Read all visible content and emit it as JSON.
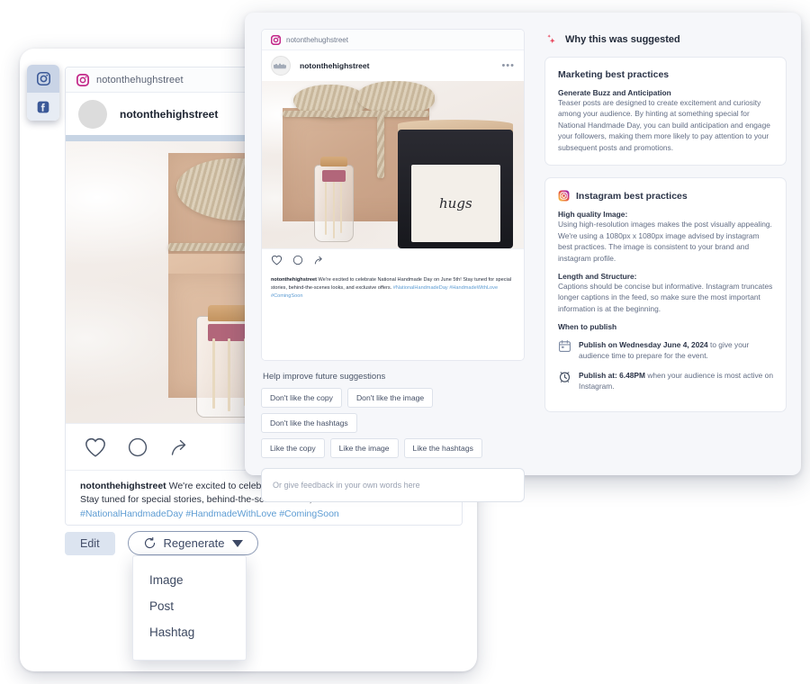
{
  "channels": [
    {
      "name": "instagram-channel-button",
      "icon": "instagram-icon",
      "active": true
    },
    {
      "name": "facebook-channel-button",
      "icon": "facebook-icon",
      "active": false
    }
  ],
  "post_preview": {
    "tab_label": "notonthehughstreet",
    "account_name": "notonthehighstreet",
    "caption_user": "notonthehighstreet",
    "caption_text": "We're excited to celebrate National Handmade Day on June 5th! Stay tuned for special stories, behind-the-scenes looks, and exclusive offers.",
    "hashtags": "#NationalHandmadeDay #HandmadeWithLove #ComingSoon",
    "image_alt_label": "hugs",
    "actions": [
      "like-icon",
      "comment-icon",
      "share-icon"
    ],
    "more_options": "•••"
  },
  "footer": {
    "edit_label": "Edit",
    "regenerate_label": "Regenerate"
  },
  "regenerate_menu": {
    "items": [
      "Image",
      "Post",
      "Hashtag"
    ]
  },
  "feedback": {
    "title": "Help improve future suggestions",
    "negative_chips": [
      "Don't like the copy",
      "Don't like the image",
      "Don't like the hashtags"
    ],
    "positive_chips": [
      "Like the copy",
      "Like the image",
      "Like the hashtags"
    ],
    "input_placeholder": "Or give feedback in your own words here"
  },
  "why_panel": {
    "title": "Why this was suggested",
    "marketing_card": {
      "heading": "Marketing best practices",
      "sub_heading": "Generate Buzz and Anticipation",
      "body": "Teaser posts are designed to create excitement and curiosity among your audience. By hinting at something special for National Handmade Day, you can build anticipation and engage your followers, making them more likely to pay attention to your subsequent posts and promotions."
    },
    "instagram_card": {
      "heading": "Instagram best practices",
      "sections": [
        {
          "sub_heading": "High quality Image:",
          "body": "Using high-resolution images makes the post visually appealing. We're using a 1080px x 1080px image advised by instagram best practices. The image is consistent to your brand and instagram profile."
        },
        {
          "sub_heading": "Length and Structure:",
          "body": "Captions should be concise but informative. Instagram truncates longer captions in the feed, so make sure the most important information is at the beginning."
        }
      ],
      "publish_heading": "When to publish",
      "publish_items": [
        {
          "icon": "calendar-icon",
          "bold": "Publish on Wednesday June 4, 2024",
          "rest": " to give your audience time to prepare for the event."
        },
        {
          "icon": "clock-icon",
          "bold": "Publish at: 6.48PM",
          "rest": " when your audience is most active on Instagram."
        }
      ]
    }
  },
  "colors": {
    "instagram_magenta": "#c3298a",
    "facebook_blue": "#3b5998",
    "hashtag_blue": "#5d9cd3",
    "sparkle_red": "#e8465c",
    "panel_bg": "#f6f7fa",
    "edit_bg": "#dce4f0"
  }
}
